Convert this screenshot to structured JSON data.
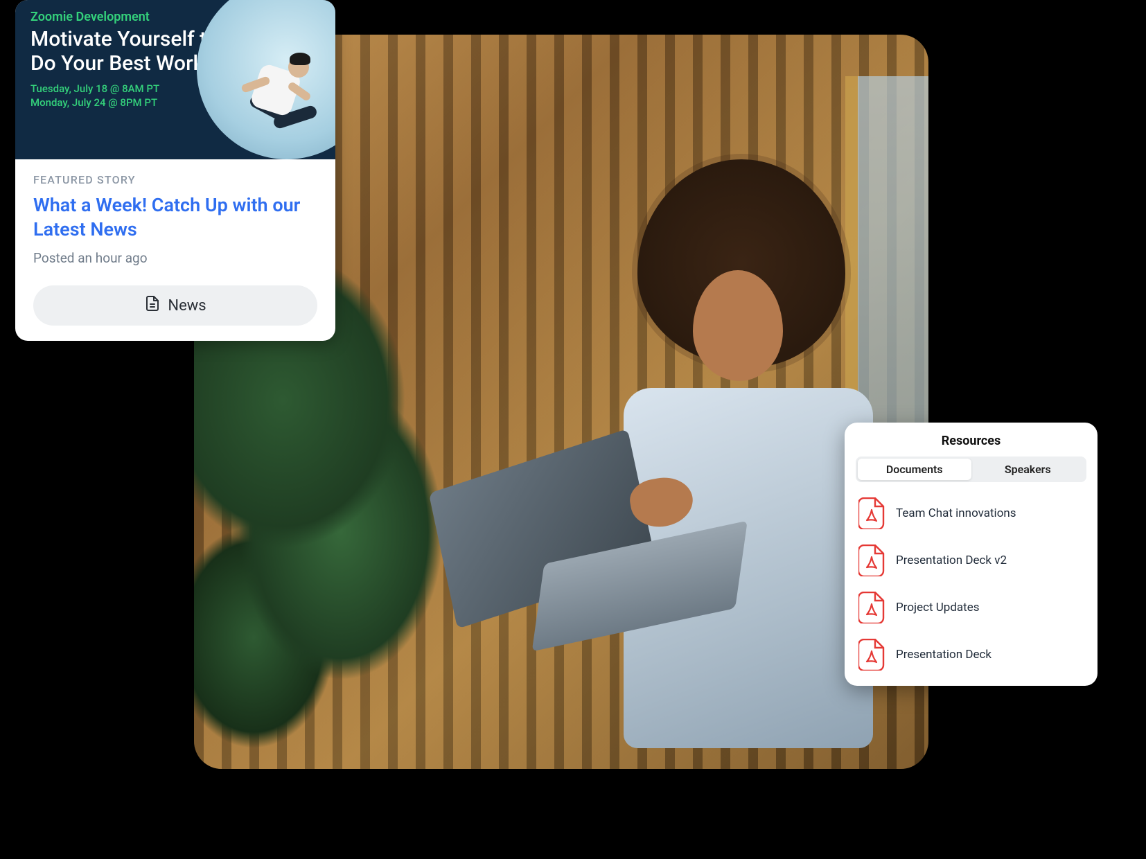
{
  "news_card": {
    "brand": "Zoomie Development",
    "title": "Motivate Yourself to Do Your Best Work",
    "date_line_1": "Tuesday, July 18 @ 8AM PT",
    "date_line_2": "Monday, July 24 @ 8PM PT",
    "eyebrow": "FEATURED STORY",
    "story_title": "What a Week! Catch Up with our Latest News",
    "posted": "Posted an hour ago",
    "button_label": "News"
  },
  "resources": {
    "title": "Resources",
    "tabs": {
      "documents": "Documents",
      "speakers": "Speakers"
    },
    "active_tab": "documents",
    "items": [
      {
        "label": "Team Chat innovations",
        "type": "pdf"
      },
      {
        "label": "Presentation Deck v2",
        "type": "pdf"
      },
      {
        "label": "Project Updates",
        "type": "pdf"
      },
      {
        "label": "Presentation Deck",
        "type": "pdf"
      }
    ]
  },
  "colors": {
    "accent_green": "#34d17b",
    "link_blue": "#2f6ef0",
    "pdf_red": "#e53935",
    "hero_navy": "#102a43"
  }
}
